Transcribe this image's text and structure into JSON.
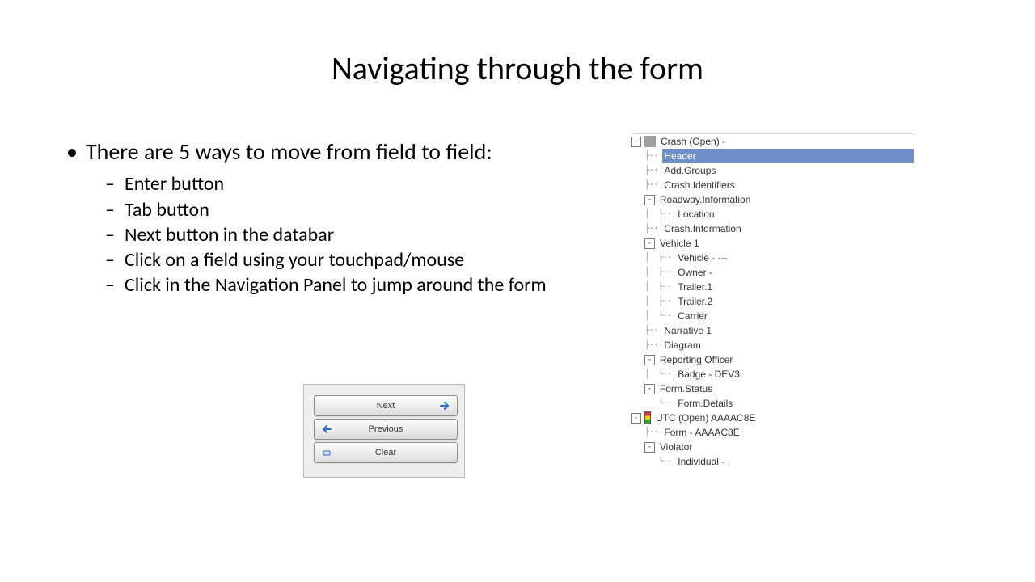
{
  "title": "Navigating through the form",
  "bullet": "There are 5 ways to move from field to field:",
  "subs": [
    "Enter button",
    "Tab button",
    "Next button in the databar",
    "Click on a field using your touchpad/mouse",
    "Click in the Navigation Panel to jump around the form"
  ],
  "databar": {
    "next": "Next",
    "prev": "Previous",
    "clear": "Clear"
  },
  "tree": {
    "root1": "Crash (Open) -",
    "header": "Header",
    "items1": [
      "Add.Groups",
      "Crash.Identifiers"
    ],
    "roadway": "Roadway.Information",
    "location": "Location",
    "crashinfo": "Crash.Information",
    "vehicle1": "Vehicle 1",
    "veh_children": [
      "Vehicle - ---",
      "Owner -",
      "Trailer.1",
      "Trailer.2",
      "Carrier"
    ],
    "narrative": "Narrative 1",
    "diagram": "Diagram",
    "reporting": "Reporting.Officer",
    "badge": "Badge - DEV3",
    "formstatus": "Form.Status",
    "formdetails": "Form.Details",
    "root2": "UTC (Open) AAAAC8E",
    "form2": "Form - AAAAC8E",
    "violator": "Violator",
    "individual": "Individual - ,"
  }
}
